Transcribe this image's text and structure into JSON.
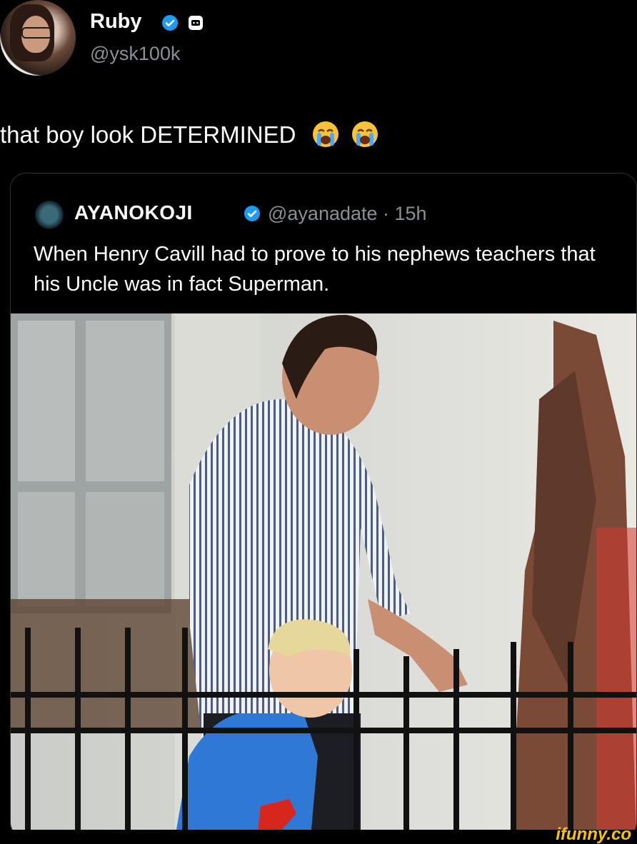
{
  "author": {
    "name": "Ruby",
    "handle": "@ysk100k",
    "avatar_icon": "profile-photo",
    "verified_icon": "verified-badge-icon"
  },
  "tweet": {
    "text": "that boy look DETERMINED",
    "emoji": [
      "loudly-crying-face",
      "loudly-crying-face"
    ]
  },
  "quote": {
    "name": "AYANOKOJI",
    "handle_time": "@ayanadate · 15h",
    "text": "When Henry Cavill had to prove to his nephews teachers that his Uncle was in fact Superman.",
    "photo_icon": "photo-man-striped-shirt-boy-superman-shirt"
  },
  "watermark": "ifunny.co",
  "colors": {
    "background": "#000000",
    "verified": "#1d9bf0",
    "secondary_text": "#8a8f96",
    "watermark": "#f8c400"
  }
}
